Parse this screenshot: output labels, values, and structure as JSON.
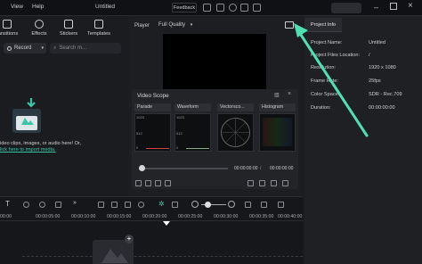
{
  "topbar": {
    "menu": [
      "View",
      "Help"
    ],
    "title": "Untitled",
    "feedback": "Feedback"
  },
  "media": {
    "tabs": [
      "ransitions",
      "Effects",
      "Stickers",
      "Templates"
    ],
    "record": "Record",
    "search_placeholder": "Search m...",
    "hint_line1": "ideo clips, images, or audio here! Or,",
    "hint_link": "lick here to import media."
  },
  "player": {
    "label": "Player",
    "quality": "Full Quality",
    "scope": {
      "title": "Video Scope",
      "dropdowns": [
        "Parade",
        "Waveform",
        "Vectorsco...",
        "Histogram"
      ],
      "scale_top": "1023",
      "scale_mid": "512",
      "scale_bottom": "0"
    },
    "timecode_current": "00:00:00:00",
    "timecode_total": "00:00:00:00"
  },
  "project_info": {
    "tab": "Project Info",
    "rows": [
      {
        "key": "Project Name:",
        "value": "Untitled"
      },
      {
        "key": "Project Files Location:",
        "value": "/"
      },
      {
        "key": "Resolution:",
        "value": "1920 x 1080"
      },
      {
        "key": "Frame Rate:",
        "value": "25fps"
      },
      {
        "key": "Color Space:",
        "value": "SDR - Rec.709"
      },
      {
        "key": "Duration:",
        "value": "00:00:00:00"
      }
    ]
  },
  "timeline": {
    "ruler": [
      "00:00",
      "00:00:05:00",
      "00:00:10:00",
      "00:00:15:00",
      "00:00:20:00",
      "00:00:25:00",
      "00:00:30:00",
      "00:00:35:00",
      "00:00:40:00",
      "00:00:45:00"
    ]
  },
  "colors": {
    "accent": "#39c6a7",
    "arrow": "#4fe0b2"
  }
}
